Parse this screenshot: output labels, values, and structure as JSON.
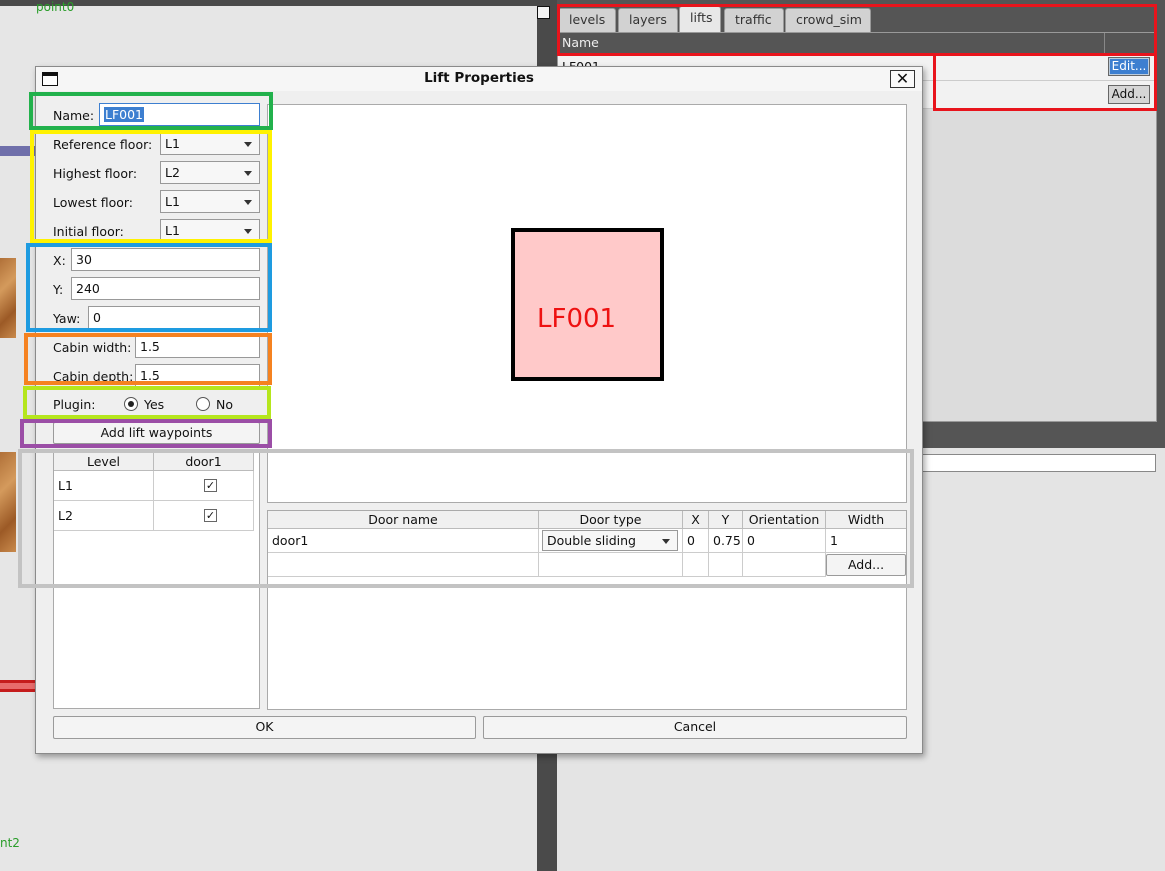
{
  "canvas": {
    "top_label": "point0",
    "bottom_label": "nt2"
  },
  "tabs": [
    {
      "label": "levels"
    },
    {
      "label": "layers"
    },
    {
      "label": "lifts"
    },
    {
      "label": "traffic"
    },
    {
      "label": "crowd_sim"
    }
  ],
  "lifts_table": {
    "column_name": "Name",
    "rows": [
      {
        "name": "LF001",
        "edit_label": "Edit..."
      }
    ],
    "add_label": "Add..."
  },
  "dialog": {
    "title": "Lift Properties",
    "close_glyph": "✕",
    "name_label": "Name:",
    "name_value": "LF001",
    "reference_floor_label": "Reference floor:",
    "reference_floor_value": "L1",
    "highest_floor_label": "Highest floor:",
    "highest_floor_value": "L2",
    "lowest_floor_label": "Lowest floor:",
    "lowest_floor_value": "L1",
    "initial_floor_label": "Initial floor:",
    "initial_floor_value": "L1",
    "x_label": "X:",
    "x_value": "30",
    "y_label": "Y:",
    "y_value": "240",
    "yaw_label": "Yaw:",
    "yaw_value": "0",
    "cabin_width_label": "Cabin width:",
    "cabin_width_value": "1.5",
    "cabin_depth_label": "Cabin depth:",
    "cabin_depth_value": "1.5",
    "plugin_label": "Plugin:",
    "plugin_yes_label": "Yes",
    "plugin_no_label": "No",
    "plugin_selected": "Yes",
    "add_waypoints_label": "Add lift waypoints",
    "level_table": {
      "col_level": "Level",
      "col_door": "door1",
      "rows": [
        {
          "level": "L1",
          "check": "✓"
        },
        {
          "level": "L2",
          "check": "✓"
        }
      ]
    },
    "preview_label": "LF001",
    "doors_table": {
      "col_name": "Door name",
      "col_type": "Door type",
      "col_x": "X",
      "col_y": "Y",
      "col_orientation": "Orientation",
      "col_width": "Width",
      "rows": [
        {
          "name": "door1",
          "type": "Double sliding",
          "x": "0",
          "y": "0.75",
          "orientation": "0",
          "width": "1"
        }
      ],
      "add_label": "Add..."
    },
    "ok_label": "OK",
    "cancel_label": "Cancel"
  },
  "colors": {
    "highlight_red": "#e8141c",
    "highlight_green": "#22b14c",
    "highlight_yellow": "#fff200",
    "highlight_blue": "#1e9be0",
    "highlight_orange": "#f58220",
    "highlight_lime": "#b5e61d",
    "highlight_purple": "#9b4ea6",
    "highlight_gray": "#c3c3c3",
    "lift_fill": "#ffc9c9",
    "lift_text": "#ee1111",
    "selection": "#3d7fd0"
  }
}
